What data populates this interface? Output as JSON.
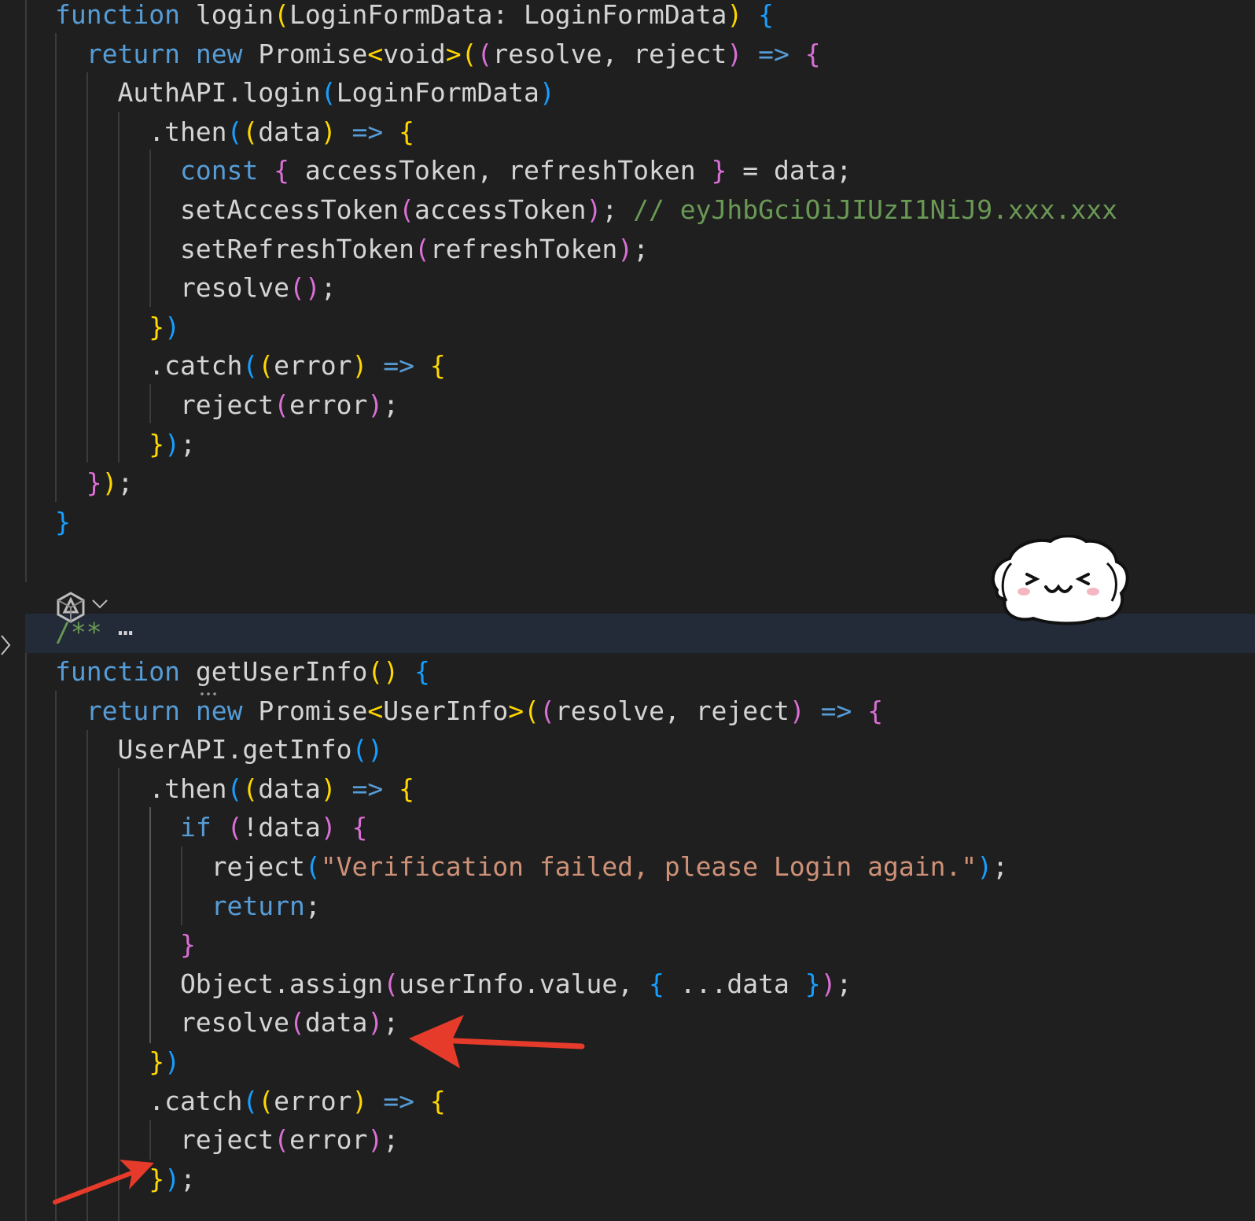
{
  "colors": {
    "background": "#1f1f1f",
    "keyword": "#569cd6",
    "control": "#569cd6",
    "identifier": "#d4d4d4",
    "string": "#ce9178",
    "comment": "#6a9955",
    "bracket_gold": "#ffd700",
    "bracket_pink": "#da70d6",
    "bracket_blue": "#179fff",
    "arrow_annotation": "#e63b2a"
  },
  "icons": {
    "fold_marker": "chevron-right-icon",
    "ai_sparkle": "sparkle-icon",
    "ai_dropdown": "chevron-down-icon",
    "mascot": "dog-face-sticker",
    "annotation_arrows": "red-arrow"
  },
  "code": {
    "lines": [
      [
        [
          "function",
          "kw"
        ],
        [
          " login",
          "id"
        ],
        [
          "(",
          "bg"
        ],
        [
          "LoginFormData: LoginFormData",
          "id"
        ],
        [
          ")",
          "bg"
        ],
        [
          " ",
          "id"
        ],
        [
          "{",
          "bb"
        ]
      ],
      [
        [
          "  ",
          "id"
        ],
        [
          "return",
          "kw"
        ],
        [
          " ",
          "id"
        ],
        [
          "new",
          "kw"
        ],
        [
          " Promise",
          "id"
        ],
        [
          "<",
          "bg"
        ],
        [
          "void",
          "id"
        ],
        [
          ">",
          "bg"
        ],
        [
          "(",
          "bg"
        ],
        [
          "(",
          "bp"
        ],
        [
          "resolve, reject",
          "id"
        ],
        [
          ")",
          "bp"
        ],
        [
          " ",
          "id"
        ],
        [
          "=>",
          "kw"
        ],
        [
          " ",
          "id"
        ],
        [
          "{",
          "bp"
        ]
      ],
      [
        [
          "    AuthAPI.login",
          "id"
        ],
        [
          "(",
          "bb"
        ],
        [
          "LoginFormData",
          "id"
        ],
        [
          ")",
          "bb"
        ]
      ],
      [
        [
          "      .then",
          "id"
        ],
        [
          "(",
          "bb"
        ],
        [
          "(",
          "bg"
        ],
        [
          "data",
          "id"
        ],
        [
          ")",
          "bg"
        ],
        [
          " ",
          "id"
        ],
        [
          "=>",
          "kw"
        ],
        [
          " ",
          "id"
        ],
        [
          "{",
          "bg"
        ]
      ],
      [
        [
          "        ",
          "id"
        ],
        [
          "const",
          "kw"
        ],
        [
          " ",
          "id"
        ],
        [
          "{",
          "bp"
        ],
        [
          " accessToken, refreshToken ",
          "id"
        ],
        [
          "}",
          "bp"
        ],
        [
          " = data;",
          "id"
        ]
      ],
      [
        [
          "        setAccessToken",
          "id"
        ],
        [
          "(",
          "bp"
        ],
        [
          "accessToken",
          "id"
        ],
        [
          ")",
          "bp"
        ],
        [
          "; ",
          "id"
        ],
        [
          "// eyJhbGciOiJIUzI1NiJ9.xxx.xxx",
          "cm"
        ]
      ],
      [
        [
          "        setRefreshToken",
          "id"
        ],
        [
          "(",
          "bp"
        ],
        [
          "refreshToken",
          "id"
        ],
        [
          ")",
          "bp"
        ],
        [
          ";",
          "id"
        ]
      ],
      [
        [
          "        resolve",
          "id"
        ],
        [
          "()",
          "bp"
        ],
        [
          ";",
          "id"
        ]
      ],
      [
        [
          "      ",
          "id"
        ],
        [
          "}",
          "bg"
        ],
        [
          ")",
          "bb"
        ]
      ],
      [
        [
          "      .catch",
          "id"
        ],
        [
          "(",
          "bb"
        ],
        [
          "(",
          "bg"
        ],
        [
          "error",
          "id"
        ],
        [
          ")",
          "bg"
        ],
        [
          " ",
          "id"
        ],
        [
          "=>",
          "kw"
        ],
        [
          " ",
          "id"
        ],
        [
          "{",
          "bg"
        ]
      ],
      [
        [
          "        reject",
          "id"
        ],
        [
          "(",
          "bp"
        ],
        [
          "error",
          "id"
        ],
        [
          ")",
          "bp"
        ],
        [
          ";",
          "id"
        ]
      ],
      [
        [
          "      ",
          "id"
        ],
        [
          "}",
          "bg"
        ],
        [
          ")",
          "bb"
        ],
        [
          ";",
          "id"
        ]
      ],
      [
        [
          "  ",
          "id"
        ],
        [
          "}",
          "bp"
        ],
        [
          ")",
          "bg"
        ],
        [
          ";",
          "id"
        ]
      ],
      [
        [
          "}",
          "bb"
        ]
      ],
      [
        [
          "",
          "id"
        ]
      ],
      [
        [
          "",
          "id"
        ]
      ],
      [
        [
          "/** ",
          "cm"
        ],
        [
          "⋯",
          "id"
        ]
      ],
      [
        [
          "function",
          "kw"
        ],
        [
          " getUserInfo",
          "id"
        ],
        [
          "()",
          "bg"
        ],
        [
          " ",
          "id"
        ],
        [
          "{",
          "bb"
        ]
      ],
      [
        [
          "  ",
          "id"
        ],
        [
          "return",
          "kw"
        ],
        [
          " ",
          "id"
        ],
        [
          "new",
          "kw"
        ],
        [
          " Promise",
          "id"
        ],
        [
          "<",
          "bg"
        ],
        [
          "UserInfo",
          "id"
        ],
        [
          ">",
          "bg"
        ],
        [
          "(",
          "bg"
        ],
        [
          "(",
          "bp"
        ],
        [
          "resolve, reject",
          "id"
        ],
        [
          ")",
          "bp"
        ],
        [
          " ",
          "id"
        ],
        [
          "=>",
          "kw"
        ],
        [
          " ",
          "id"
        ],
        [
          "{",
          "bp"
        ]
      ],
      [
        [
          "    UserAPI.getInfo",
          "id"
        ],
        [
          "()",
          "bb"
        ]
      ],
      [
        [
          "      .then",
          "id"
        ],
        [
          "(",
          "bb"
        ],
        [
          "(",
          "bg"
        ],
        [
          "data",
          "id"
        ],
        [
          ")",
          "bg"
        ],
        [
          " ",
          "id"
        ],
        [
          "=>",
          "kw"
        ],
        [
          " ",
          "id"
        ],
        [
          "{",
          "bg"
        ]
      ],
      [
        [
          "        ",
          "id"
        ],
        [
          "if",
          "kw"
        ],
        [
          " ",
          "id"
        ],
        [
          "(",
          "bp"
        ],
        [
          "!data",
          "id"
        ],
        [
          ")",
          "bp"
        ],
        [
          " ",
          "id"
        ],
        [
          "{",
          "bp"
        ]
      ],
      [
        [
          "          reject",
          "id"
        ],
        [
          "(",
          "bb"
        ],
        [
          "\"Verification failed, please Login again.\"",
          "st"
        ],
        [
          ")",
          "bb"
        ],
        [
          ";",
          "id"
        ]
      ],
      [
        [
          "          ",
          "id"
        ],
        [
          "return",
          "kw"
        ],
        [
          ";",
          "id"
        ]
      ],
      [
        [
          "        ",
          "id"
        ],
        [
          "}",
          "bp"
        ]
      ],
      [
        [
          "        Object.assign",
          "id"
        ],
        [
          "(",
          "bp"
        ],
        [
          "userInfo.value, ",
          "id"
        ],
        [
          "{",
          "bb"
        ],
        [
          " ...data ",
          "id"
        ],
        [
          "}",
          "bb"
        ],
        [
          ")",
          "bp"
        ],
        [
          ";",
          "id"
        ]
      ],
      [
        [
          "        resolve",
          "id"
        ],
        [
          "(",
          "bp"
        ],
        [
          "data",
          "id"
        ],
        [
          ")",
          "bp"
        ],
        [
          ";",
          "id"
        ]
      ],
      [
        [
          "      ",
          "id"
        ],
        [
          "}",
          "bg"
        ],
        [
          ")",
          "bb"
        ]
      ],
      [
        [
          "      .catch",
          "id"
        ],
        [
          "(",
          "bb"
        ],
        [
          "(",
          "bg"
        ],
        [
          "error",
          "id"
        ],
        [
          ")",
          "bg"
        ],
        [
          " ",
          "id"
        ],
        [
          "=>",
          "kw"
        ],
        [
          " ",
          "id"
        ],
        [
          "{",
          "bg"
        ]
      ],
      [
        [
          "        reject",
          "id"
        ],
        [
          "(",
          "bp"
        ],
        [
          "error",
          "id"
        ],
        [
          ")",
          "bp"
        ],
        [
          ";",
          "id"
        ]
      ],
      [
        [
          "      ",
          "id"
        ],
        [
          "}",
          "bg"
        ],
        [
          ")",
          "bb"
        ],
        [
          ";",
          "id"
        ]
      ]
    ]
  }
}
